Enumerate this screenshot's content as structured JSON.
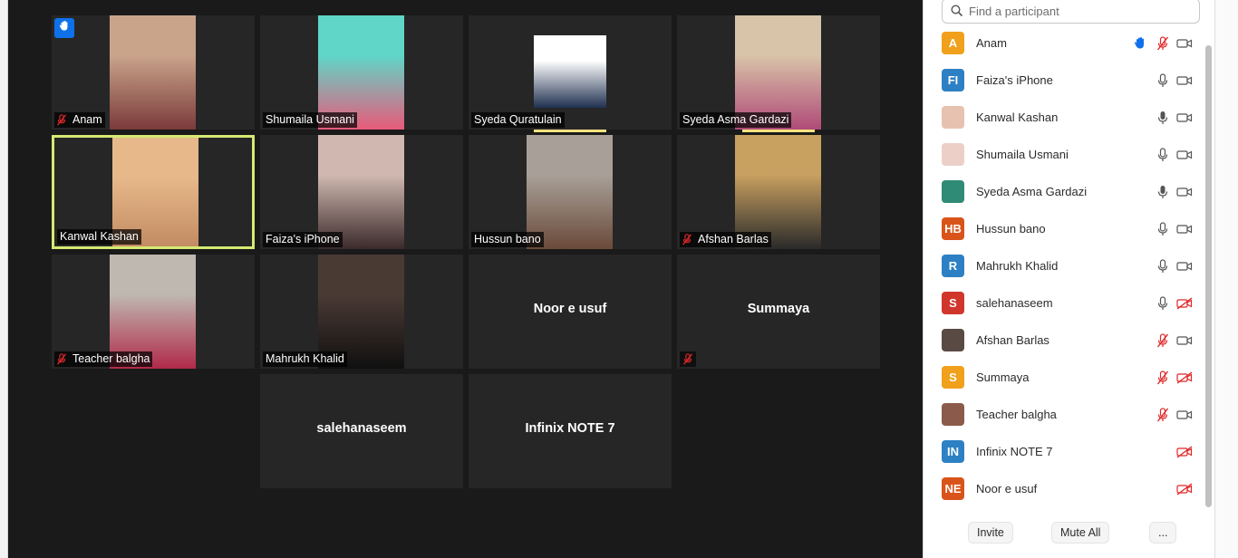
{
  "gallery": {
    "tiles": [
      {
        "name": "Anam",
        "muted": true,
        "hand_raised": true
      },
      {
        "name": "Shumaila Usmani",
        "muted": false
      },
      {
        "name": "Syeda Quratulain",
        "muted": false
      },
      {
        "name": "Syeda Asma Gardazi",
        "muted": false
      },
      {
        "name": "Kanwal Kashan",
        "muted": false,
        "active_speaker": true
      },
      {
        "name": "Faiza's iPhone",
        "muted": false
      },
      {
        "name": "Hussun bano",
        "muted": false
      },
      {
        "name": "Afshan Barlas",
        "muted": true
      },
      {
        "name": "Teacher balgha",
        "muted": true
      },
      {
        "name": "Mahrukh Khalid",
        "muted": false
      },
      {
        "name": "Noor e usuf",
        "video_off": true
      },
      {
        "name": "Summaya",
        "video_off": true,
        "muted": true
      },
      {
        "name": "salehanaseem",
        "video_off": true
      },
      {
        "name": "Infinix NOTE 7",
        "video_off": true
      }
    ]
  },
  "participants_panel": {
    "search_placeholder": "Find a participant",
    "participants": [
      {
        "initials": "A",
        "name": "Anam",
        "avatar_color": "#f0a01a",
        "hand_raised": true,
        "mic": "muted",
        "video": "on"
      },
      {
        "initials": "FI",
        "name": "Faiza's iPhone",
        "avatar_color": "#2d80c4",
        "mic": "on",
        "video": "on"
      },
      {
        "initials": "",
        "name": "Kanwal Kashan",
        "avatar_color": "#e8c2b0",
        "mic": "speaking",
        "video": "on"
      },
      {
        "initials": "",
        "name": "Shumaila Usmani",
        "avatar_color": "#ecd0c8",
        "mic": "on",
        "video": "on"
      },
      {
        "initials": "",
        "name": "Syeda Asma Gardazi",
        "avatar_color": "#2f8a76",
        "mic": "speaking",
        "video": "on"
      },
      {
        "initials": "HB",
        "name": "Hussun bano",
        "avatar_color": "#d9541a",
        "mic": "on",
        "video": "on"
      },
      {
        "initials": "R",
        "name": "Mahrukh Khalid",
        "avatar_color": "#2d80c4",
        "mic": "on",
        "video": "on"
      },
      {
        "initials": "S",
        "name": "salehanaseem",
        "avatar_color": "#d0362b",
        "mic": "on",
        "video": "off"
      },
      {
        "initials": "",
        "name": "Afshan Barlas",
        "avatar_color": "#5a4a44",
        "mic": "muted",
        "video": "on"
      },
      {
        "initials": "S",
        "name": "Summaya",
        "avatar_color": "#f0a01a",
        "mic": "muted",
        "video": "off"
      },
      {
        "initials": "",
        "name": "Teacher balgha",
        "avatar_color": "#8c5a4a",
        "mic": "muted",
        "video": "on"
      },
      {
        "initials": "IN",
        "name": "Infinix NOTE 7",
        "avatar_color": "#2d80c4",
        "mic": "none",
        "video": "off"
      },
      {
        "initials": "NE",
        "name": "Noor e usuf",
        "avatar_color": "#d9541a",
        "mic": "none",
        "video": "off"
      }
    ],
    "footer": {
      "invite_label": "Invite",
      "mute_all_label": "Mute All",
      "more_label": "..."
    }
  },
  "colors": {
    "stage_bg": "#1a1a1a",
    "tile_bg": "#262626",
    "active_border": "#d4ea72",
    "mute_red": "#e02828",
    "hand_blue": "#0e71eb"
  }
}
